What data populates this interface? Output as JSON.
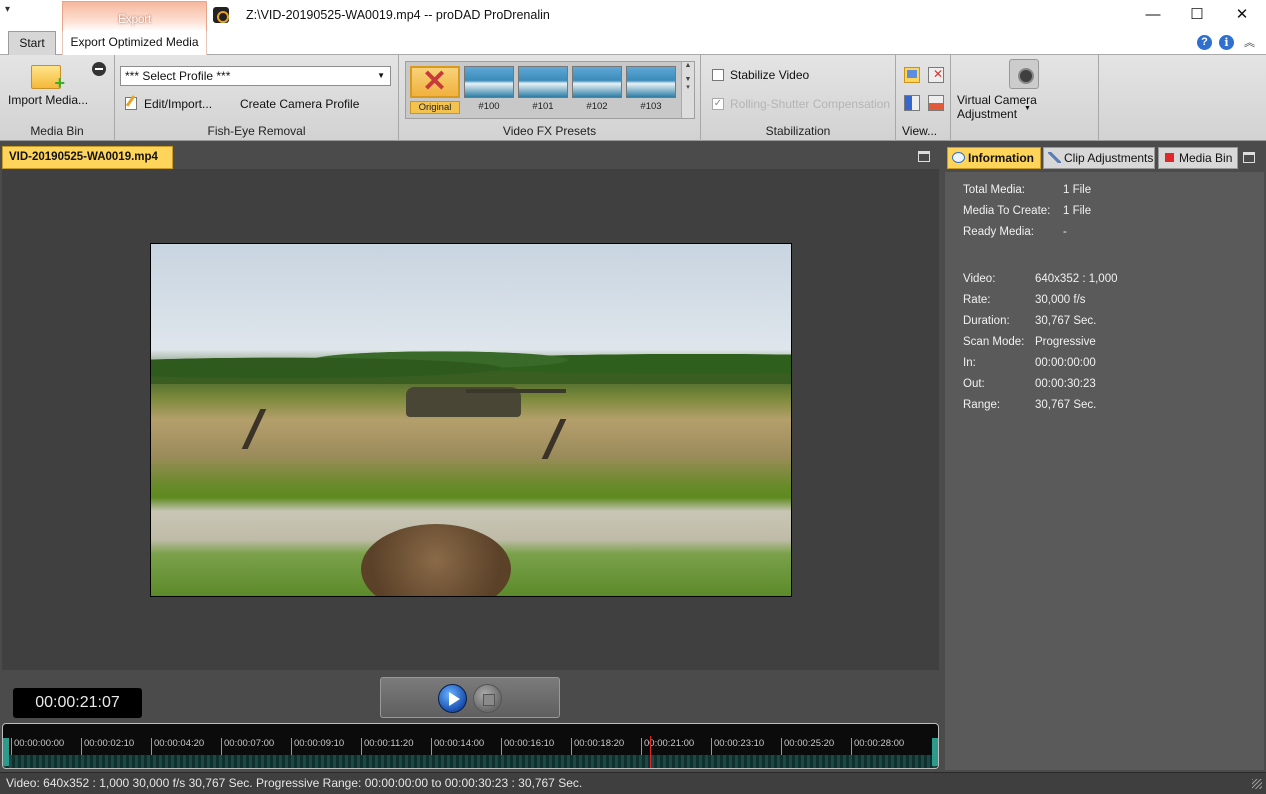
{
  "titlebar": {
    "context_tab": "Export",
    "window_title": "Z:\\VID-20190525-WA0019.mp4 -- proDAD ProDrenalin",
    "minimize": "—",
    "maximize": "☐",
    "close": "✕"
  },
  "ribbon_tabs": {
    "start": "Start",
    "export_optimized": "Export Optimized Media"
  },
  "ribbon": {
    "media_bin": {
      "import_label": "Import Media...",
      "group_label": "Media Bin"
    },
    "fisheye": {
      "profile_select": "*** Select Profile ***",
      "edit_import": "Edit/Import...",
      "create_profile": "Create Camera Profile",
      "group_label": "Fish-Eye Removal"
    },
    "presets": {
      "items": [
        {
          "label": "Original"
        },
        {
          "label": "#100"
        },
        {
          "label": "#101"
        },
        {
          "label": "#102"
        },
        {
          "label": "#103"
        }
      ],
      "group_label": "Video FX Presets"
    },
    "stabilization": {
      "stabilize_label": "Stabilize Video",
      "rolling_label": "Rolling-Shutter Compensation",
      "rolling_check": "✓",
      "group_label": "Stabilization"
    },
    "view": {
      "group_label": "View..."
    },
    "vca": {
      "label": "Virtual Camera Adjustment"
    }
  },
  "document": {
    "tab_label": "VID-20190525-WA0019.mp4"
  },
  "player": {
    "timecode": "00:00:21:07",
    "playhead_position": 0.692
  },
  "timeline": {
    "ticks": [
      "00:00:00:00",
      "00:00:02:10",
      "00:00:04:20",
      "00:00:07:00",
      "00:00:09:10",
      "00:00:11:20",
      "00:00:14:00",
      "00:00:16:10",
      "00:00:18:20",
      "00:00:21:00",
      "00:00:23:10",
      "00:00:25:20",
      "00:00:28:00"
    ]
  },
  "right_panel": {
    "tabs": {
      "information": "Information",
      "clip_adjustments": "Clip Adjustments",
      "media_bin": "Media Bin"
    },
    "info_rows": [
      {
        "label": "Total Media:",
        "value": "1 File"
      },
      {
        "label": "Media To Create:",
        "value": "1 File"
      },
      {
        "label": "Ready Media:",
        "value": "-"
      },
      {
        "label": "Video:",
        "value": "640x352 : 1,000"
      },
      {
        "label": "Rate:",
        "value": "30,000 f/s"
      },
      {
        "label": "Duration:",
        "value": "30,767 Sec."
      },
      {
        "label": "Scan Mode:",
        "value": "Progressive"
      },
      {
        "label": "In:",
        "value": "00:00:00:00"
      },
      {
        "label": "Out:",
        "value": "00:00:30:23"
      },
      {
        "label": "Range:",
        "value": "30,767 Sec."
      }
    ]
  },
  "statusbar": {
    "text": "Video: 640x352 : 1,000  30,000 f/s  30,767 Sec.  Progressive  Range: 00:00:00:00 to 00:00:30:23 : 30,767 Sec."
  }
}
